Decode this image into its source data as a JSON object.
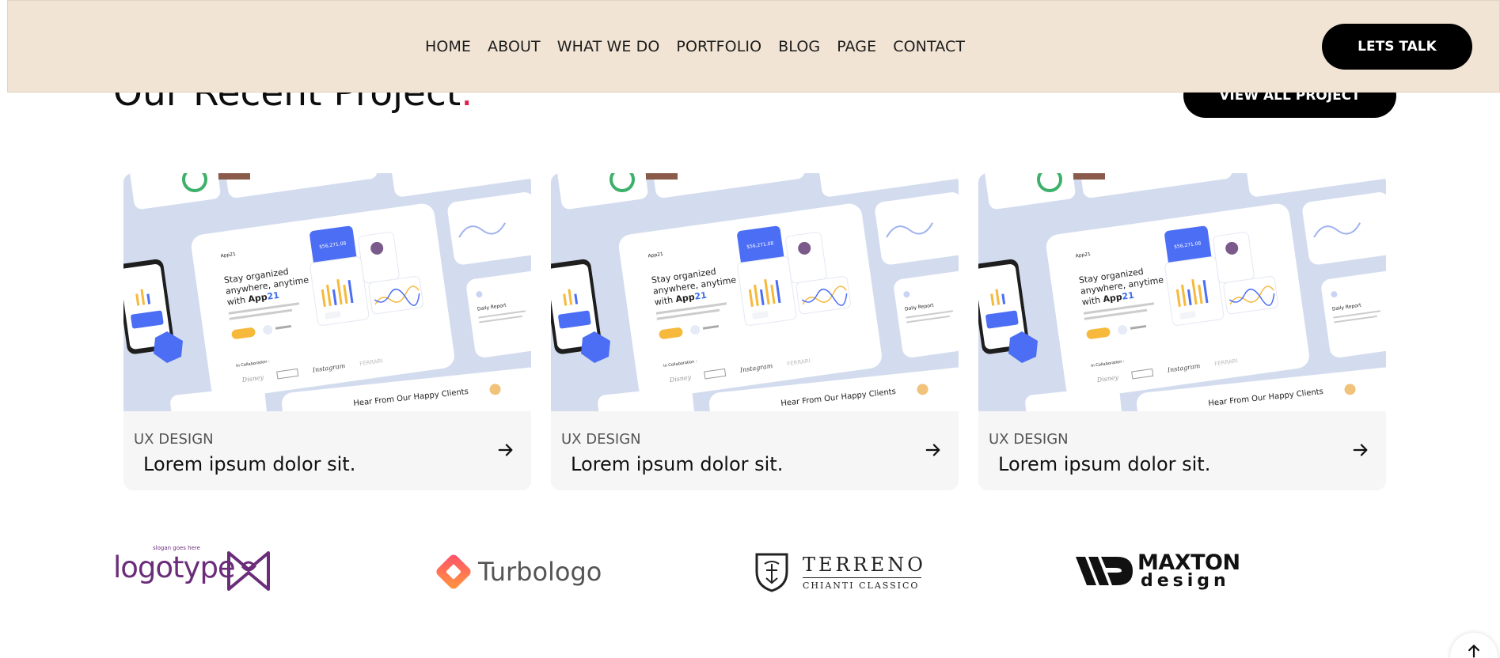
{
  "nav": {
    "items": [
      "HOME",
      "ABOUT",
      "WHAT WE DO",
      "PORTFOLIO",
      "BLOG",
      "PAGE",
      "CONTACT"
    ],
    "cta_label": "LETS TALK"
  },
  "section": {
    "title": "Our Recent Project",
    "title_dot": ".",
    "view_all_label": "VIEW ALL PROJECT"
  },
  "projects": [
    {
      "category": "UX DESIGN",
      "title": "Lorem ipsum dolor sit."
    },
    {
      "category": "UX DESIGN",
      "title": "Lorem ipsum dolor sit."
    },
    {
      "category": "UX DESIGN",
      "title": "Lorem ipsum dolor sit."
    }
  ],
  "mockup": {
    "brand": "App21",
    "headline_1": "Stay organized",
    "headline_2": "anywhere, anytime",
    "headline_3": "with App21",
    "collab": "In Collaboration :",
    "partners": [
      "Disney",
      "BBC",
      "Instagram",
      "FERRARI"
    ],
    "testimonial": "Hear From Our Happy Clients",
    "daily_report": "Daily Report"
  },
  "logos": {
    "logotype": "logotype",
    "logotype_tagline": "slogan goes here",
    "turbologo": "Turbologo",
    "terreno": "TERRENO",
    "terreno_sub": "CHIANTI CLASSICO",
    "maxton_1": "MAXTON",
    "maxton_2": "design"
  },
  "colors": {
    "header_bg": "#f1e4d4",
    "accent_dot": "#e11d48",
    "button_bg": "#000000",
    "card_bg": "#f6f6f6",
    "logotype_purple": "#6b2d7a"
  }
}
